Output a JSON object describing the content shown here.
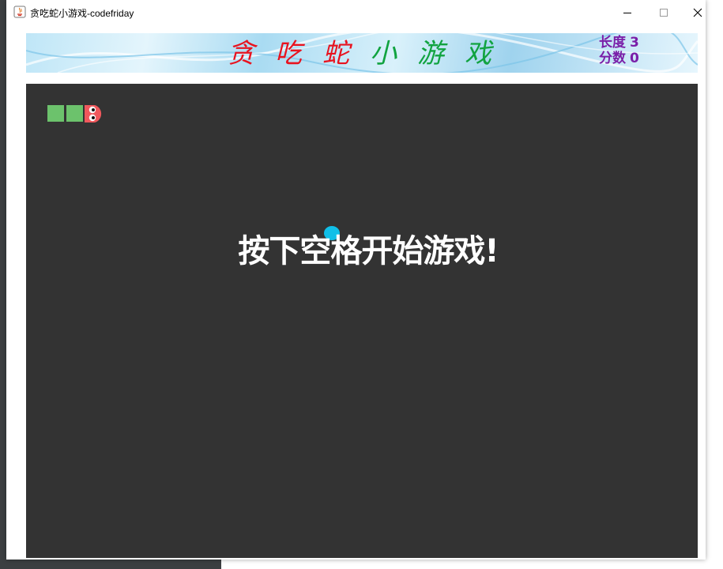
{
  "window": {
    "title": "贪吃蛇小游戏-codefriday",
    "controls": {
      "minimize": "—",
      "maximize": "☐",
      "close": "✕"
    }
  },
  "banner": {
    "title_chars": [
      "贪",
      "吃",
      "蛇",
      "小",
      "游",
      "戏"
    ],
    "title_colors": [
      "#e8131f",
      "#11a340"
    ],
    "length_label": "长度",
    "length_value": "3",
    "score_label": "分数",
    "score_value": "0",
    "stats_color": "#7a1fa8"
  },
  "game": {
    "board_color": "#333333",
    "snake_color": "#6cc26c",
    "snake_head_color": "#f0585c",
    "food_color": "#10bfe8",
    "snake_length": 3,
    "message": "按下空格开始游戏!"
  },
  "icons": {
    "app": "java-app-icon",
    "snake_head": "snake-head-icon"
  }
}
